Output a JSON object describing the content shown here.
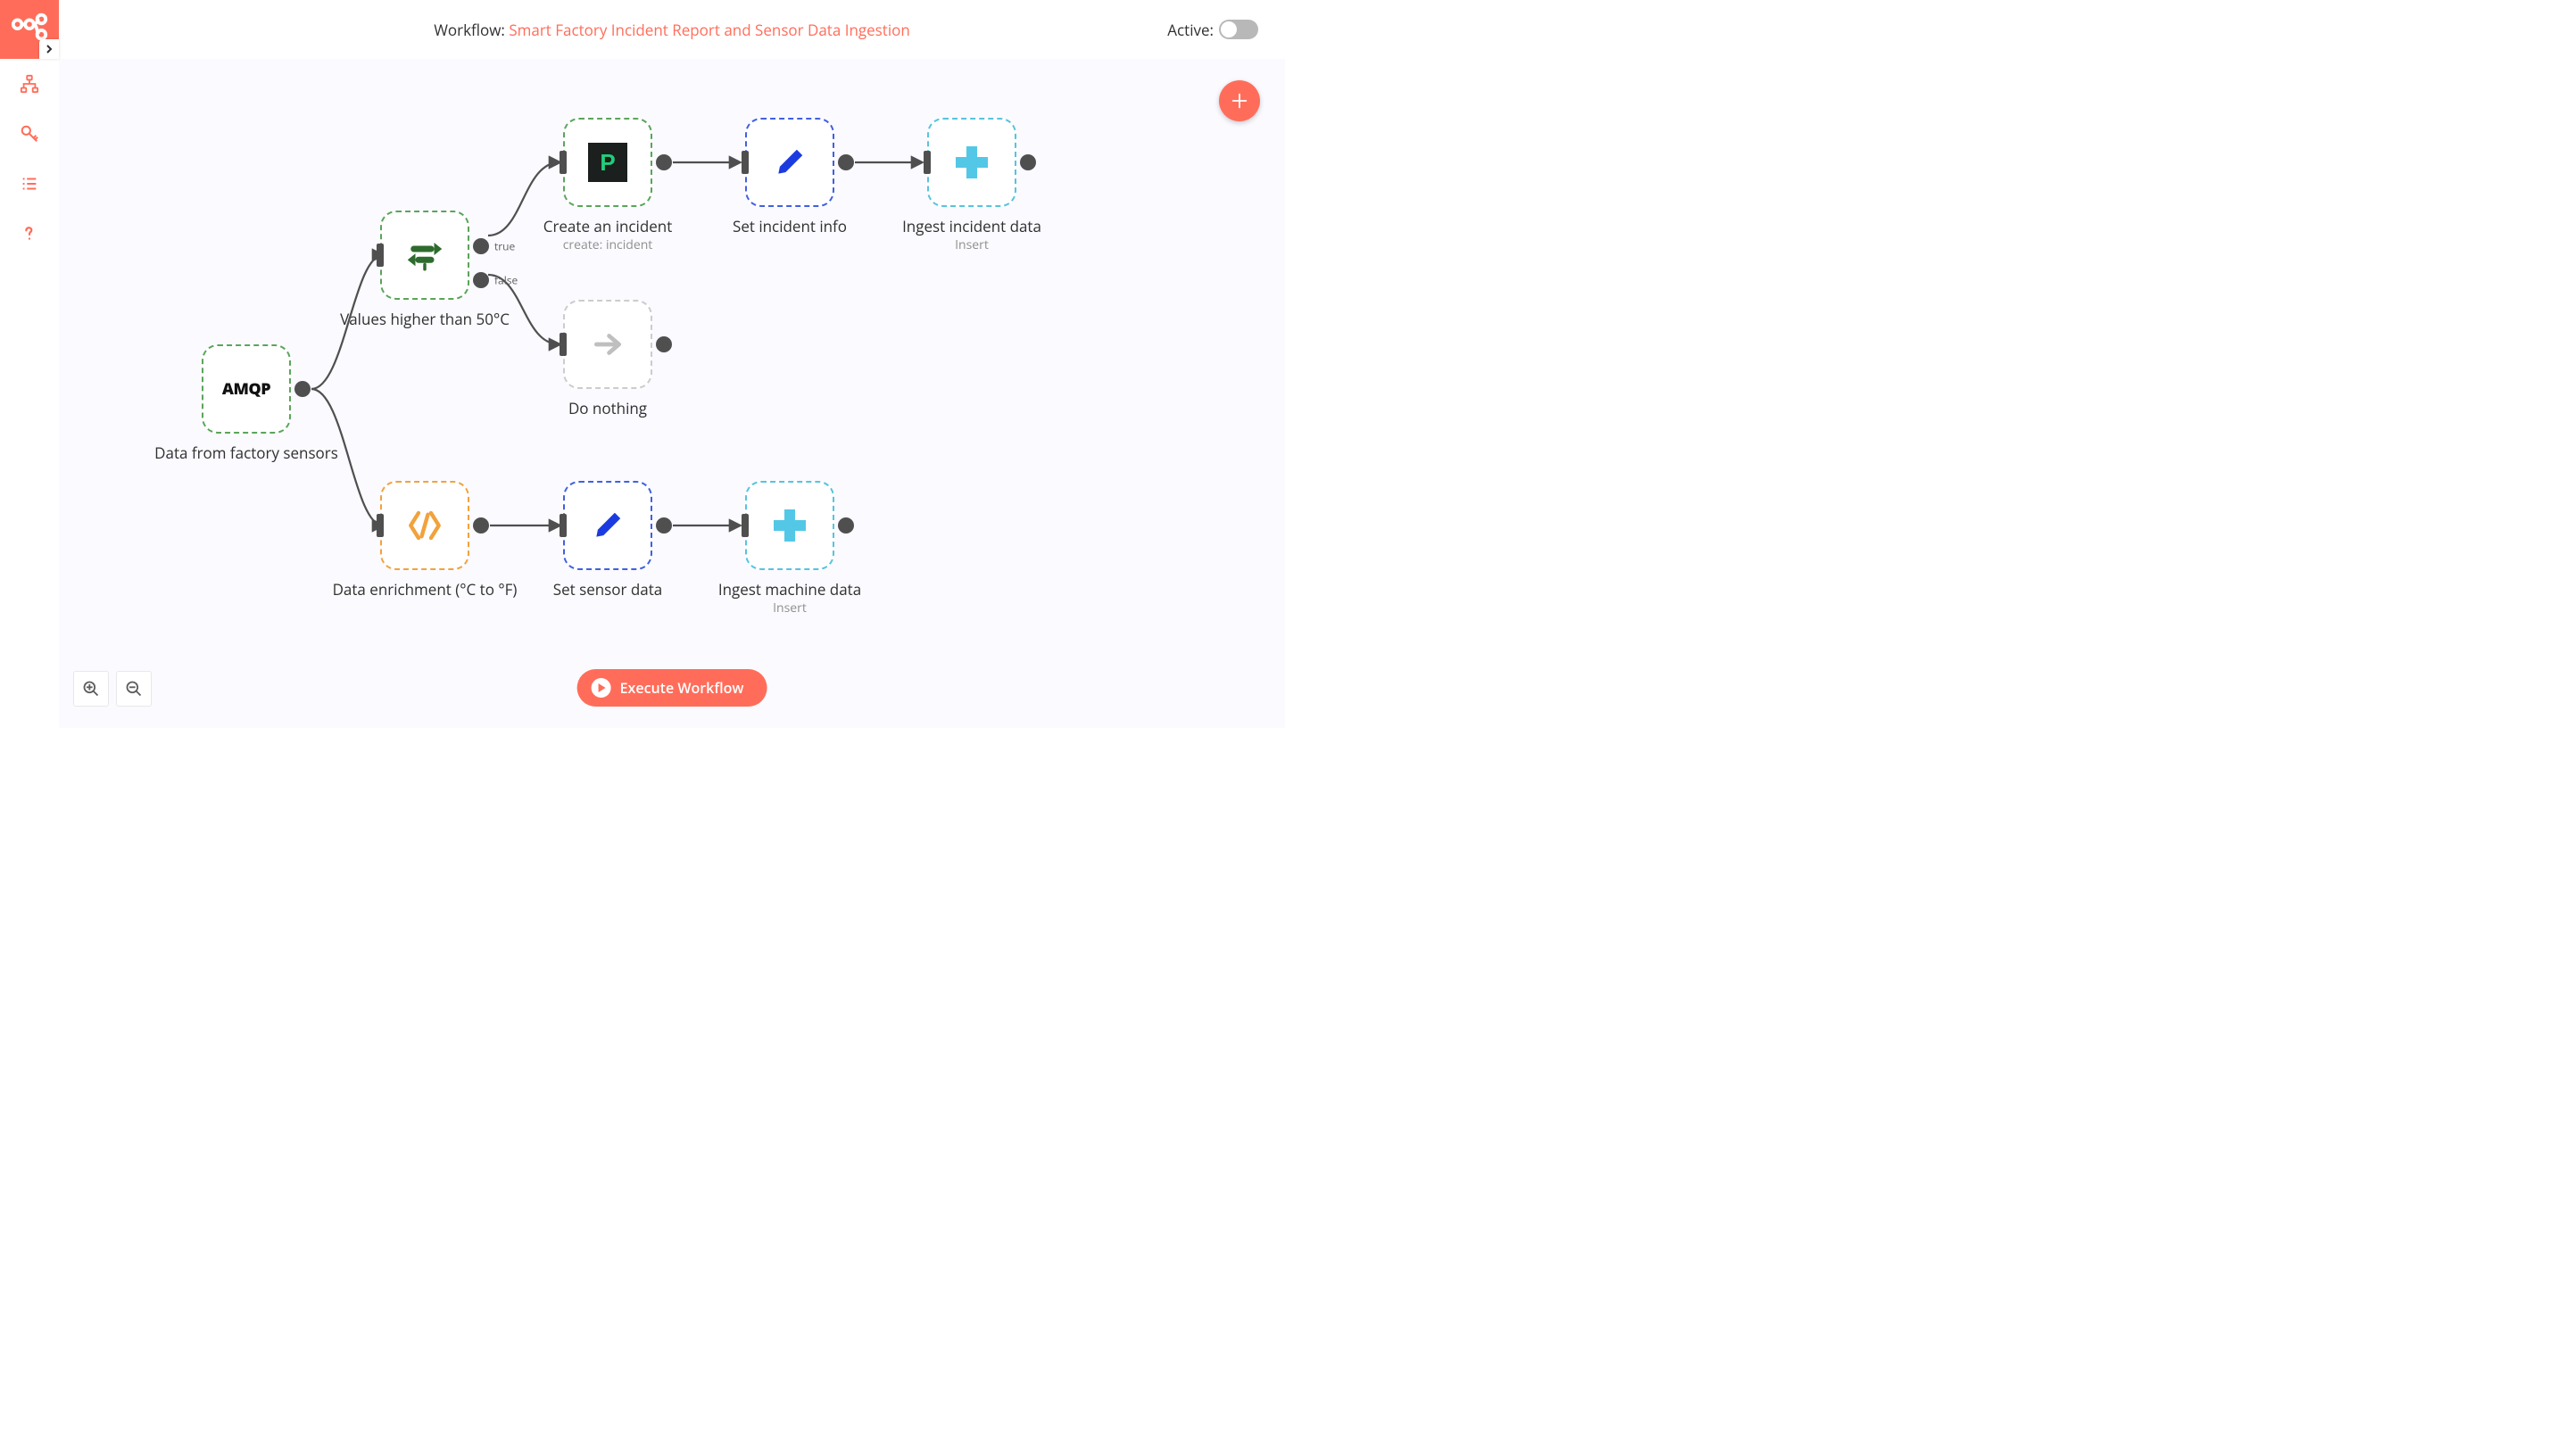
{
  "header": {
    "prefix": "Workflow: ",
    "workflow_name": "Smart Factory Incident Report and Sensor Data Ingestion",
    "active_label": "Active: ",
    "active": false
  },
  "sidebar": {
    "items": [
      "workflows",
      "credentials",
      "executions",
      "help"
    ]
  },
  "buttons": {
    "execute": "Execute Workflow",
    "add_node_tooltip": "Add node"
  },
  "canvas": {
    "zoom": 100
  },
  "nodes": {
    "trigger": {
      "label": "Data from factory sensors",
      "icon_text": "AMQP"
    },
    "if": {
      "label": "Values higher than 50°C",
      "out_true": "true",
      "out_false": "false"
    },
    "enrich": {
      "label": "Data enrichment (°C to °F)"
    },
    "incident": {
      "label": "Create an incident",
      "sub": "create: incident",
      "icon_text": "P"
    },
    "noop": {
      "label": "Do nothing"
    },
    "set1": {
      "label": "Set incident info"
    },
    "set2": {
      "label": "Set sensor data"
    },
    "ingest1": {
      "label": "Ingest incident data",
      "sub": "Insert"
    },
    "ingest2": {
      "label": "Ingest machine data",
      "sub": "Insert"
    }
  },
  "colors": {
    "accent": "#ff6d5a",
    "wire": "#4f4f4f"
  }
}
